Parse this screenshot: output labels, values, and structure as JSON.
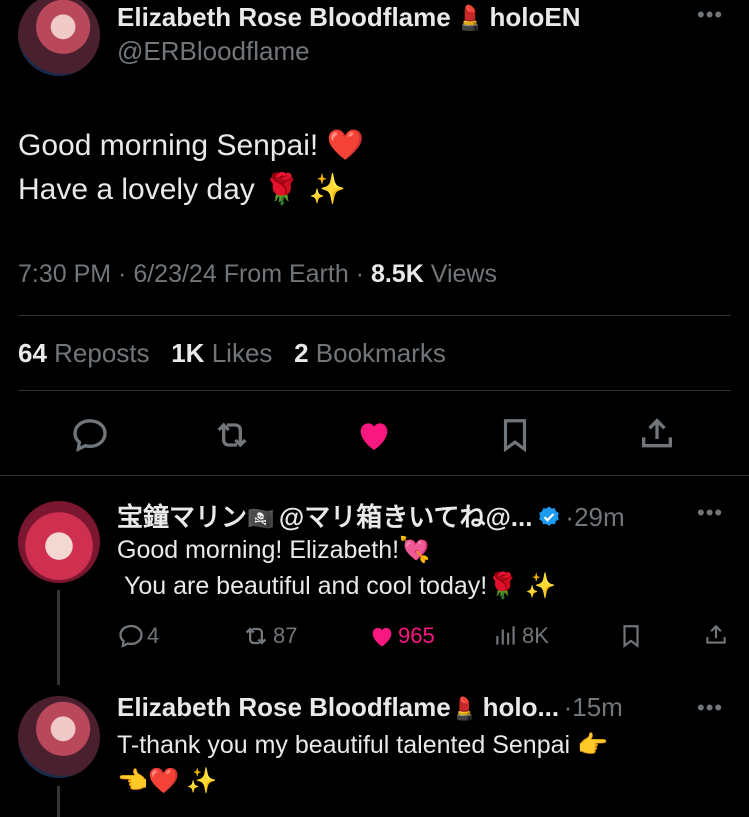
{
  "tweet": {
    "author_name": "Elizabeth Rose Bloodflame",
    "author_emoji": "💄",
    "author_suffix": "holoEN",
    "handle": "@ERBloodflame",
    "line1": "Good morning Senpai!",
    "line1_emoji": "❤️",
    "line2": "Have a lovely day",
    "line2_emoji": "🌹",
    "line2_emoji2": "✨",
    "time": "7:30 PM",
    "date": "6/23/24",
    "location": "From Earth",
    "views_count": "8.5K",
    "views_label": "Views",
    "reposts_count": "64",
    "reposts_label": "Reposts",
    "likes_count": "1K",
    "likes_label": "Likes",
    "bookmarks_count": "2",
    "bookmarks_label": "Bookmarks"
  },
  "replies": [
    {
      "author_name": "宝鐘マリン",
      "author_flag": "🏴‍☠️",
      "author_suffix": "@マリ箱きいてね@...",
      "time": "29m",
      "line1": "Good morning! Elizabeth!",
      "line1_emoji": "💘",
      "line2": "You are beautiful and cool today!",
      "line2_emoji": "🌹",
      "line2_emoji2": "✨",
      "reply_count": "4",
      "repost_count": "87",
      "like_count": "965",
      "view_count": "8K"
    },
    {
      "author_name": "Elizabeth Rose Bloodflame",
      "author_emoji": "💄",
      "author_suffix": "holo...",
      "time": "15m",
      "line1": "T-thank you my beautiful talented Senpai",
      "line1_emoji": "👉",
      "line2_emoji": "👈",
      "line2_emoji2": "❤️",
      "line2_emoji3": "✨"
    }
  ],
  "colors": {
    "background": "#000000",
    "text": "#e7e9ea",
    "muted": "#71767b",
    "like": "#f91880",
    "verified": "#1d9bf0"
  },
  "icons": [
    "more-icon",
    "reply-icon",
    "repost-icon",
    "like-icon",
    "bookmark-icon",
    "share-icon",
    "views-icon",
    "verified-icon"
  ]
}
